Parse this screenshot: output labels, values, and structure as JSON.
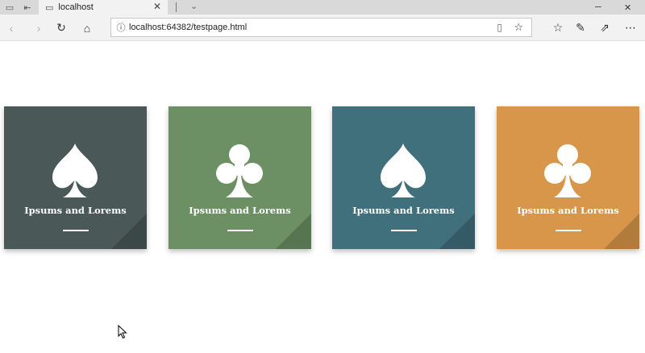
{
  "tab": {
    "title": "localhost"
  },
  "address_bar": {
    "url": "localhost:64382/testpage.html"
  },
  "cards": [
    {
      "label": "Ipsums and Lorems",
      "suit": "spade",
      "color": "#4a5858"
    },
    {
      "label": "Ipsums and Lorems",
      "suit": "club",
      "color": "#6c8f64"
    },
    {
      "label": "Ipsums and Lorems",
      "suit": "spade",
      "color": "#40707c"
    },
    {
      "label": "Ipsums and Lorems",
      "suit": "club",
      "color": "#d8964a"
    }
  ]
}
